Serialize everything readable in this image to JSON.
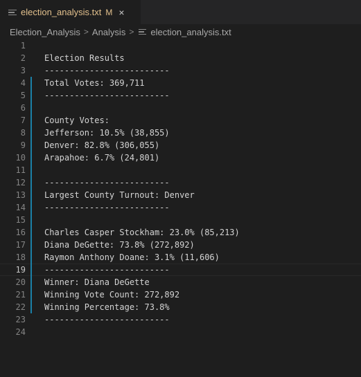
{
  "tab": {
    "filename": "election_analysis.txt",
    "status": "M",
    "close": "×"
  },
  "breadcrumb": {
    "parts": [
      "Election_Analysis",
      "Analysis",
      "election_analysis.txt"
    ],
    "separator": ">"
  },
  "editor": {
    "lines": [
      {
        "n": "1",
        "text": ""
      },
      {
        "n": "2",
        "text": "Election Results"
      },
      {
        "n": "3",
        "text": "-------------------------"
      },
      {
        "n": "4",
        "text": "Total Votes: 369,711"
      },
      {
        "n": "5",
        "text": "-------------------------"
      },
      {
        "n": "6",
        "text": ""
      },
      {
        "n": "7",
        "text": "County Votes:"
      },
      {
        "n": "8",
        "text": "Jefferson: 10.5% (38,855)"
      },
      {
        "n": "9",
        "text": "Denver: 82.8% (306,055)"
      },
      {
        "n": "10",
        "text": "Arapahoe: 6.7% (24,801)"
      },
      {
        "n": "11",
        "text": ""
      },
      {
        "n": "12",
        "text": "-------------------------"
      },
      {
        "n": "13",
        "text": "Largest County Turnout: Denver"
      },
      {
        "n": "14",
        "text": "-------------------------"
      },
      {
        "n": "15",
        "text": ""
      },
      {
        "n": "16",
        "text": "Charles Casper Stockham: 23.0% (85,213)"
      },
      {
        "n": "17",
        "text": "Diana DeGette: 73.8% (272,892)"
      },
      {
        "n": "18",
        "text": "Raymon Anthony Doane: 3.1% (11,606)"
      },
      {
        "n": "19",
        "text": "-------------------------"
      },
      {
        "n": "20",
        "text": "Winner: Diana DeGette"
      },
      {
        "n": "21",
        "text": "Winning Vote Count: 272,892"
      },
      {
        "n": "22",
        "text": "Winning Percentage: 73.8%"
      },
      {
        "n": "23",
        "text": "-------------------------"
      },
      {
        "n": "24",
        "text": ""
      }
    ],
    "current_line": "19",
    "modified_lines": [
      "4",
      "5",
      "6",
      "7",
      "8",
      "9",
      "10",
      "11",
      "12",
      "13",
      "14",
      "15",
      "16",
      "17",
      "18",
      "19",
      "20",
      "21",
      "22"
    ]
  },
  "colors": {
    "background": "#1e1e1e",
    "modified_tab": "#e2c08d",
    "gutter_modified": "#1b81a8"
  }
}
